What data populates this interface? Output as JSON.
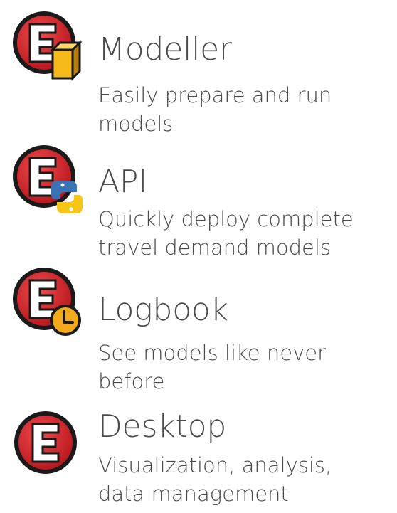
{
  "products": [
    {
      "title": "Modeller",
      "description_lines": [
        "Easily prepare and run",
        "models"
      ],
      "icon": "emme-modeller-icon"
    },
    {
      "title": "API",
      "description_lines": [
        "Quickly deploy complete",
        "travel demand models"
      ],
      "icon": "emme-api-icon"
    },
    {
      "title": "Logbook",
      "description_lines": [
        "See models like never",
        "before"
      ],
      "icon": "emme-logbook-icon"
    },
    {
      "title": "Desktop",
      "description_lines": [
        "Visualization, analysis,",
        "data management"
      ],
      "icon": "emme-desktop-icon"
    }
  ],
  "colors": {
    "logo_red": "#d8262b",
    "logo_dark_red": "#8a0f12",
    "logo_black": "#1a1a1a",
    "cube_yellow": "#f6b91a",
    "python_blue": "#3a73b3",
    "python_yellow": "#f5c518",
    "clock_orange": "#f3a91c",
    "text_gray": "#4a4a4a"
  }
}
